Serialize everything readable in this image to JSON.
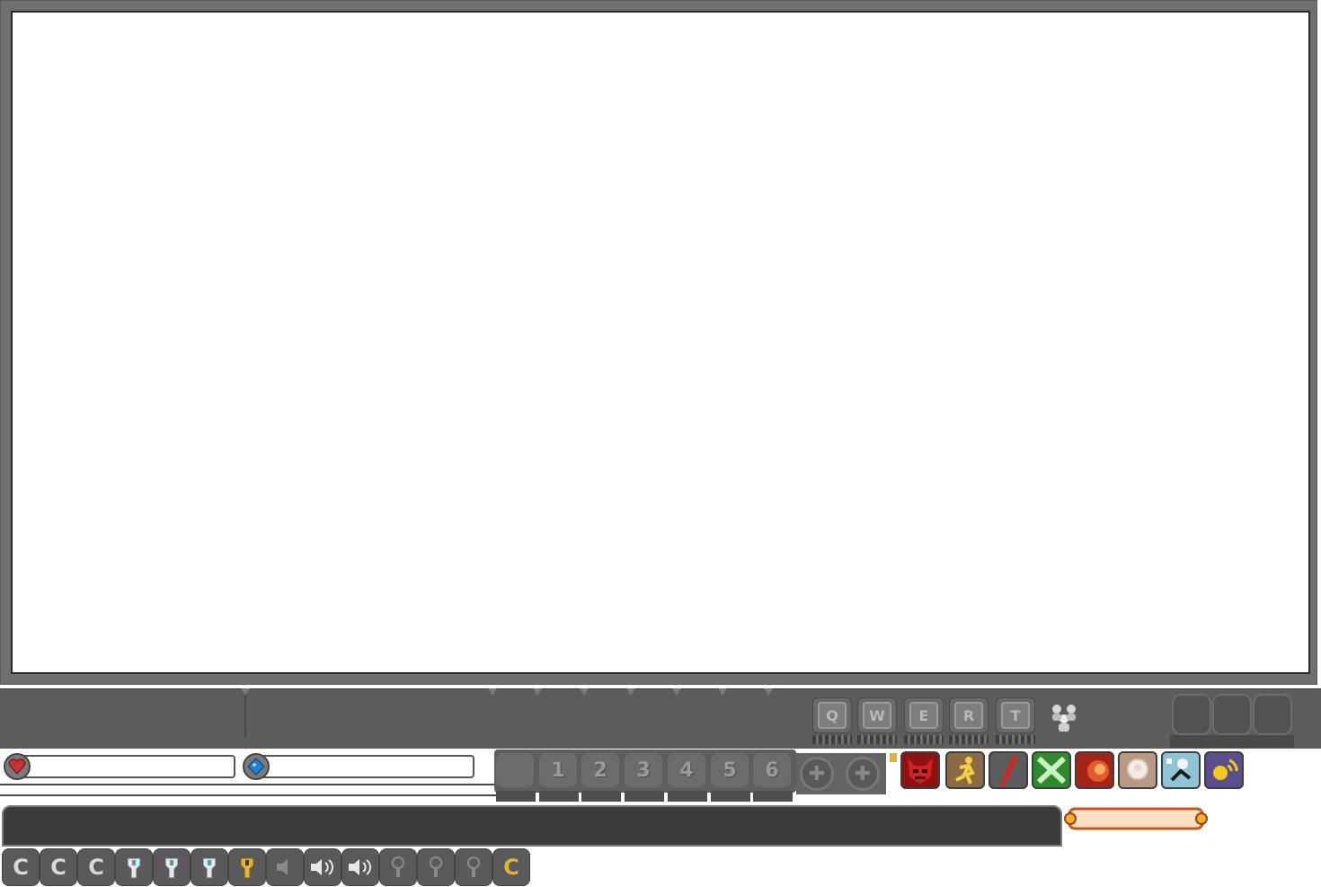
{
  "hotkeys": {
    "letters": [
      "Q",
      "W",
      "E",
      "R",
      "T"
    ]
  },
  "number_slots": [
    "1",
    "2",
    "3",
    "4",
    "5",
    "6"
  ],
  "skills": [
    {
      "name": "demon-mask-icon",
      "bg": "#8f1212"
    },
    {
      "name": "running-figure-icon",
      "bg": "#8b6a46"
    },
    {
      "name": "red-slash-icon",
      "bg": "#5c5c5c"
    },
    {
      "name": "green-x-icon",
      "bg": "#2f8a2f"
    },
    {
      "name": "fire-burst-icon",
      "bg": "#a3251a"
    },
    {
      "name": "pale-spirit-icon",
      "bg": "#b99a86"
    },
    {
      "name": "ice-figure-icon",
      "bg": "#8ec4d6"
    },
    {
      "name": "gold-aura-icon",
      "bg": "#5a4f8c"
    }
  ],
  "toolbar": {
    "items": [
      "C",
      "C",
      "C",
      "",
      "",
      "",
      "",
      "",
      "",
      "",
      "",
      "",
      "",
      "C"
    ]
  },
  "colors": {
    "health": "#c83232",
    "mana": "#1e7ed0",
    "gold": "#e2b23a"
  }
}
